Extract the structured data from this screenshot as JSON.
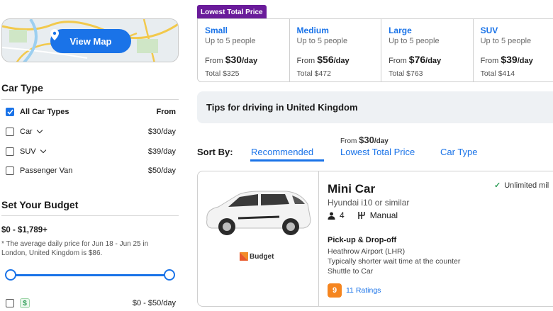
{
  "map": {
    "button_label": "View Map"
  },
  "car_type": {
    "heading": "Car Type",
    "header_row": {
      "label": "All Car Types",
      "value": "From"
    },
    "items": [
      {
        "label": "Car",
        "value": "$30/day"
      },
      {
        "label": "SUV",
        "value": "$39/day"
      },
      {
        "label": "Passenger Van",
        "value": "$50/day"
      }
    ]
  },
  "budget": {
    "heading": "Set Your Budget",
    "range": "$0 - $1,789+",
    "note": "* The average daily price for Jun 18 - Jun 25 in London, United Kingdom is $86.",
    "option_label": "$0 - $50/day",
    "option_icon": "dollar-icon"
  },
  "price_strip": {
    "badge": "Lowest Total Price",
    "tiles": [
      {
        "name": "Small",
        "people": "Up to 5 people",
        "from": "From",
        "price": "$30",
        "per": "/day",
        "total": "Total $325"
      },
      {
        "name": "Medium",
        "people": "Up to 5 people",
        "from": "From",
        "price": "$56",
        "per": "/day",
        "total": "Total $472"
      },
      {
        "name": "Large",
        "people": "Up to 5 people",
        "from": "From",
        "price": "$76",
        "per": "/day",
        "total": "Total $763"
      },
      {
        "name": "SUV",
        "people": "Up to 5 people",
        "from": "From",
        "price": "$39",
        "per": "/day",
        "total": "Total $414"
      }
    ]
  },
  "tips": {
    "text": "Tips for driving in United Kingdom"
  },
  "sort": {
    "label": "Sort By:",
    "options": [
      "Recommended",
      "Lowest Total Price",
      "Car Type"
    ],
    "from_label": "From",
    "from_price": "$30",
    "from_per": "/day"
  },
  "card": {
    "name": "Mini Car",
    "model": "Hyundai i10 or similar",
    "seats": "4",
    "transmission": "Manual",
    "brand": "Budget",
    "pickup_heading": "Pick-up & Drop-off",
    "pickup_lines": [
      "Heathrow Airport (LHR)",
      "Typically shorter wait time at the counter",
      "Shuttle to Car"
    ],
    "rating": "9",
    "ratings_label": "11 Ratings",
    "unlimited": "Unlimited mil"
  },
  "colors": {
    "accent": "#1a73e8",
    "badge": "#6a1b9a",
    "rating": "#f5851f"
  }
}
